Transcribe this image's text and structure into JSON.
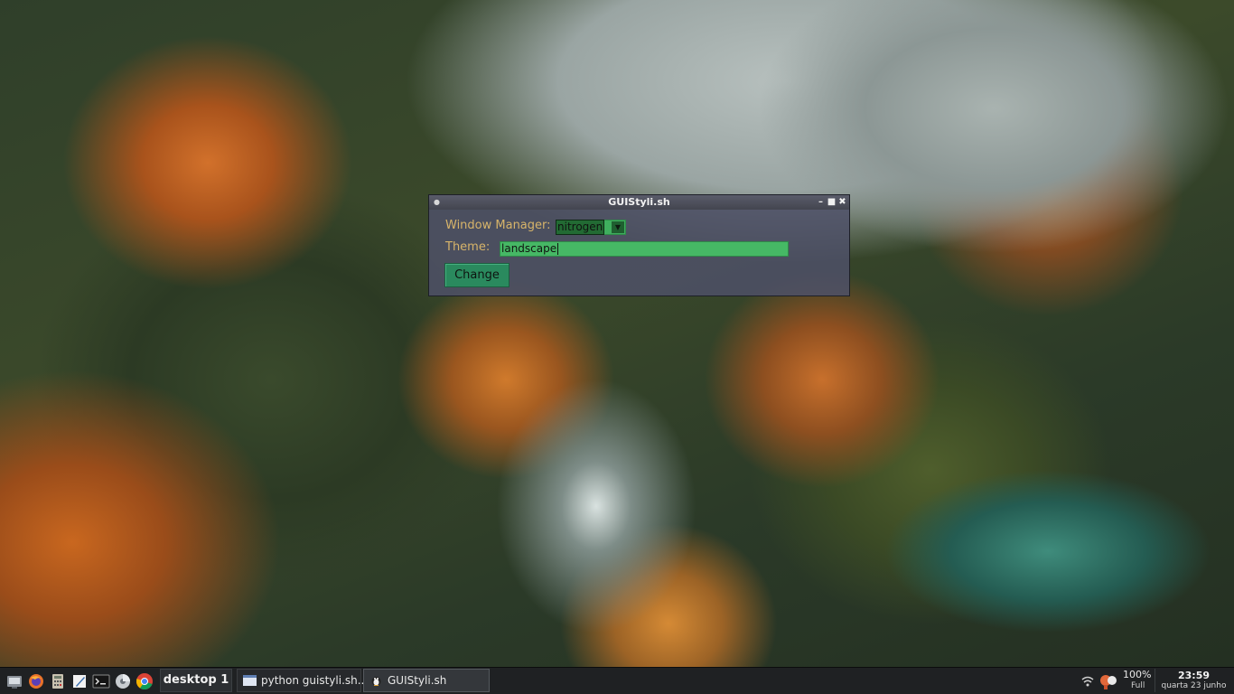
{
  "window": {
    "title": "GUIStyli.sh",
    "controls": [
      "minimize-icon",
      "maximize-icon",
      "close-icon"
    ]
  },
  "form": {
    "wm_label": "Window Manager:",
    "wm_value": "nitrogen",
    "theme_label": "Theme:",
    "theme_value": "landscape",
    "change_label": "Change"
  },
  "taskbar": {
    "launchers": [
      "file-manager-icon",
      "firefox-icon",
      "calculator-icon",
      "text-editor-icon",
      "terminal-icon",
      "disk-utility-icon",
      "chrome-icon"
    ],
    "desktop_label": "desktop 1",
    "tasks": [
      {
        "label": "python guistyli.sh...",
        "active": false
      },
      {
        "label": "GUIStyli.sh",
        "active": true
      }
    ],
    "battery_percent": "100%",
    "battery_state": "Full",
    "clock_time": "23:59",
    "clock_date": "quarta 23 junho"
  },
  "colors": {
    "accent_green": "#46b865",
    "button_green": "#2a8a5e",
    "label_gold": "#d7b46a",
    "window_bg": "#4e5068",
    "taskbar_bg": "#1f2123"
  }
}
